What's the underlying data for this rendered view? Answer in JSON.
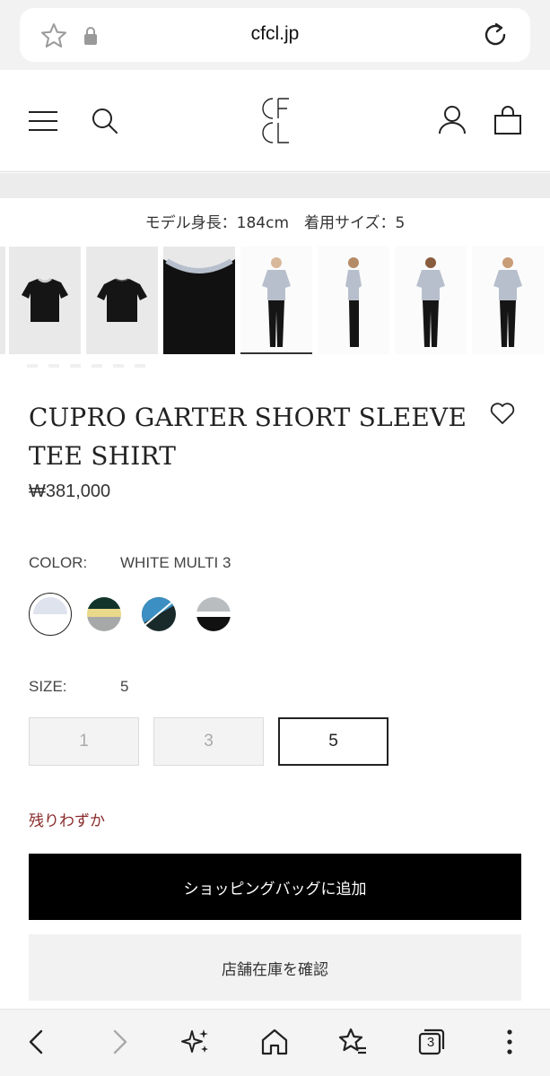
{
  "browser": {
    "url": "cfcl.jp",
    "tab_count": "3"
  },
  "header": {
    "logo_text": "CFCL"
  },
  "gallery": {
    "model_info": "モデル身長：184cm　着用サイズ：5",
    "selected_index": 4
  },
  "product": {
    "title": "CUPRO GARTER SHORT SLEEVE TEE SHIRT",
    "price": "₩381,000",
    "color_label": "COLOR:",
    "color_value": "WHITE MULTI 3",
    "size_label": "SIZE:",
    "size_value": "5",
    "sizes": [
      {
        "label": "1",
        "state": "disabled"
      },
      {
        "label": "3",
        "state": "disabled"
      },
      {
        "label": "5",
        "state": "selected"
      }
    ],
    "stock_note": "残りわずか",
    "add_to_bag": "ショッピングバッグに追加",
    "check_store_stock": "店舗在庫を確認"
  },
  "swatches": [
    {
      "name": "white-multi-3",
      "top": "#dfe3ee",
      "bottom": "#ffffff",
      "selected": true
    },
    {
      "name": "green-yellow-grey",
      "top": "#12342a",
      "mid": "#e9d98a",
      "bottom": "#a7a9a8"
    },
    {
      "name": "blue-black-diagonal",
      "top": "#3b8fc2",
      "bottom": "#1a2a2a"
    },
    {
      "name": "grey-black",
      "top": "#b9bdbf",
      "mid": "#ffffff",
      "bottom": "#111111"
    }
  ],
  "colors": {
    "primary_button": "#000000",
    "stock_note": "#8b2b2b",
    "shirt_light": "#b8bfcc",
    "shirt_dark": "#151515"
  }
}
